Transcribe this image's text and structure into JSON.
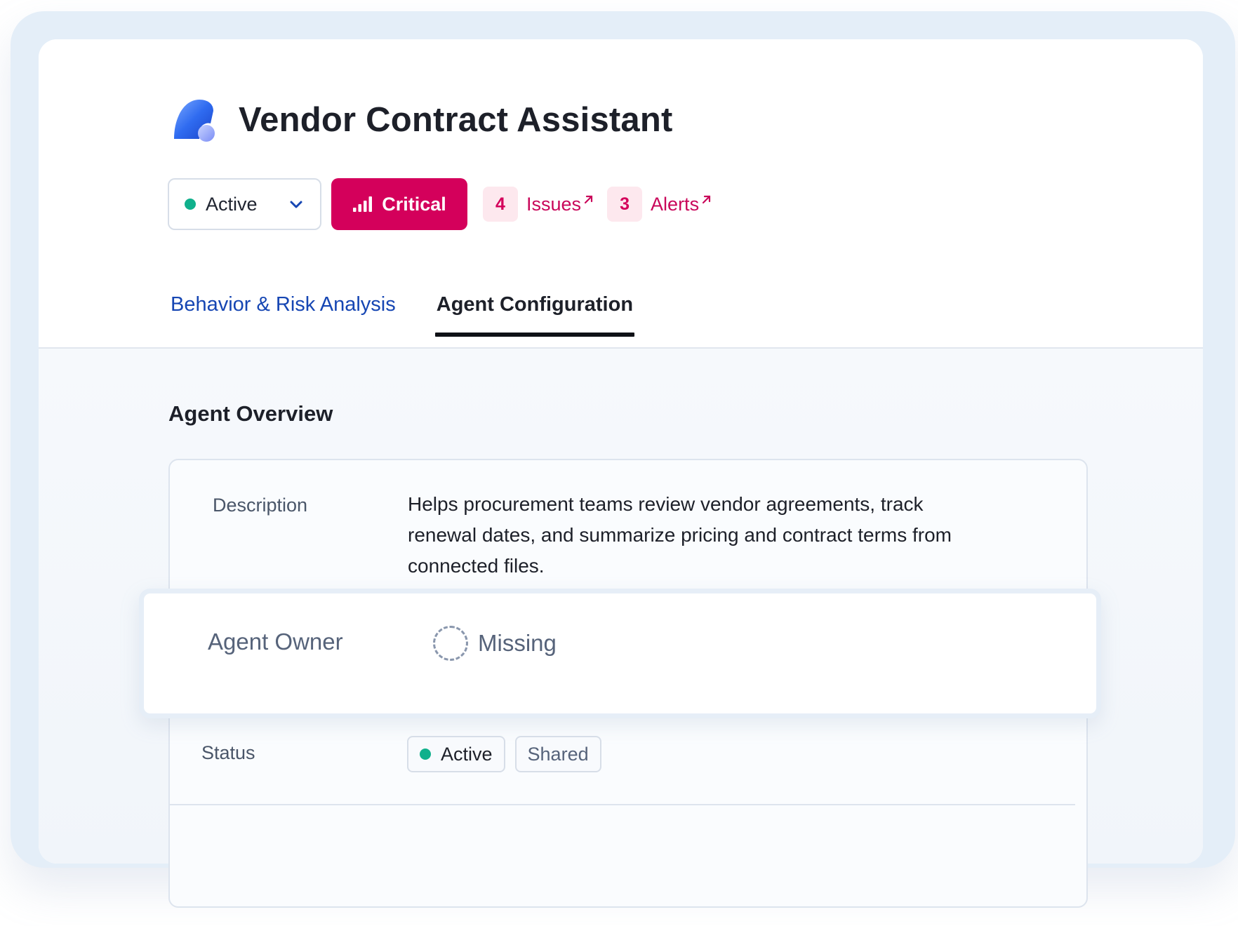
{
  "header": {
    "title": "Vendor Contract Assistant",
    "logo_icon": "agent-logo-icon"
  },
  "controls": {
    "status_dropdown": {
      "value": "Active",
      "dot_color": "#10b08c"
    },
    "severity": {
      "label": "Critical",
      "color": "#d4005b"
    },
    "issues": {
      "count": "4",
      "label": "Issues"
    },
    "alerts": {
      "count": "3",
      "label": "Alerts"
    }
  },
  "tabs": [
    {
      "label": "Behavior & Risk Analysis",
      "active": false
    },
    {
      "label": "Agent Configuration",
      "active": true
    }
  ],
  "overview": {
    "title": "Agent Overview",
    "description": {
      "label": "Description",
      "value": "Helps procurement teams review vendor agreements, track renewal dates, and summarize pricing and contract terms from connected files."
    },
    "owner": {
      "label": "Agent Owner",
      "value": "Missing"
    },
    "status": {
      "label": "Status",
      "chips": [
        "Active",
        "Shared"
      ]
    }
  }
}
